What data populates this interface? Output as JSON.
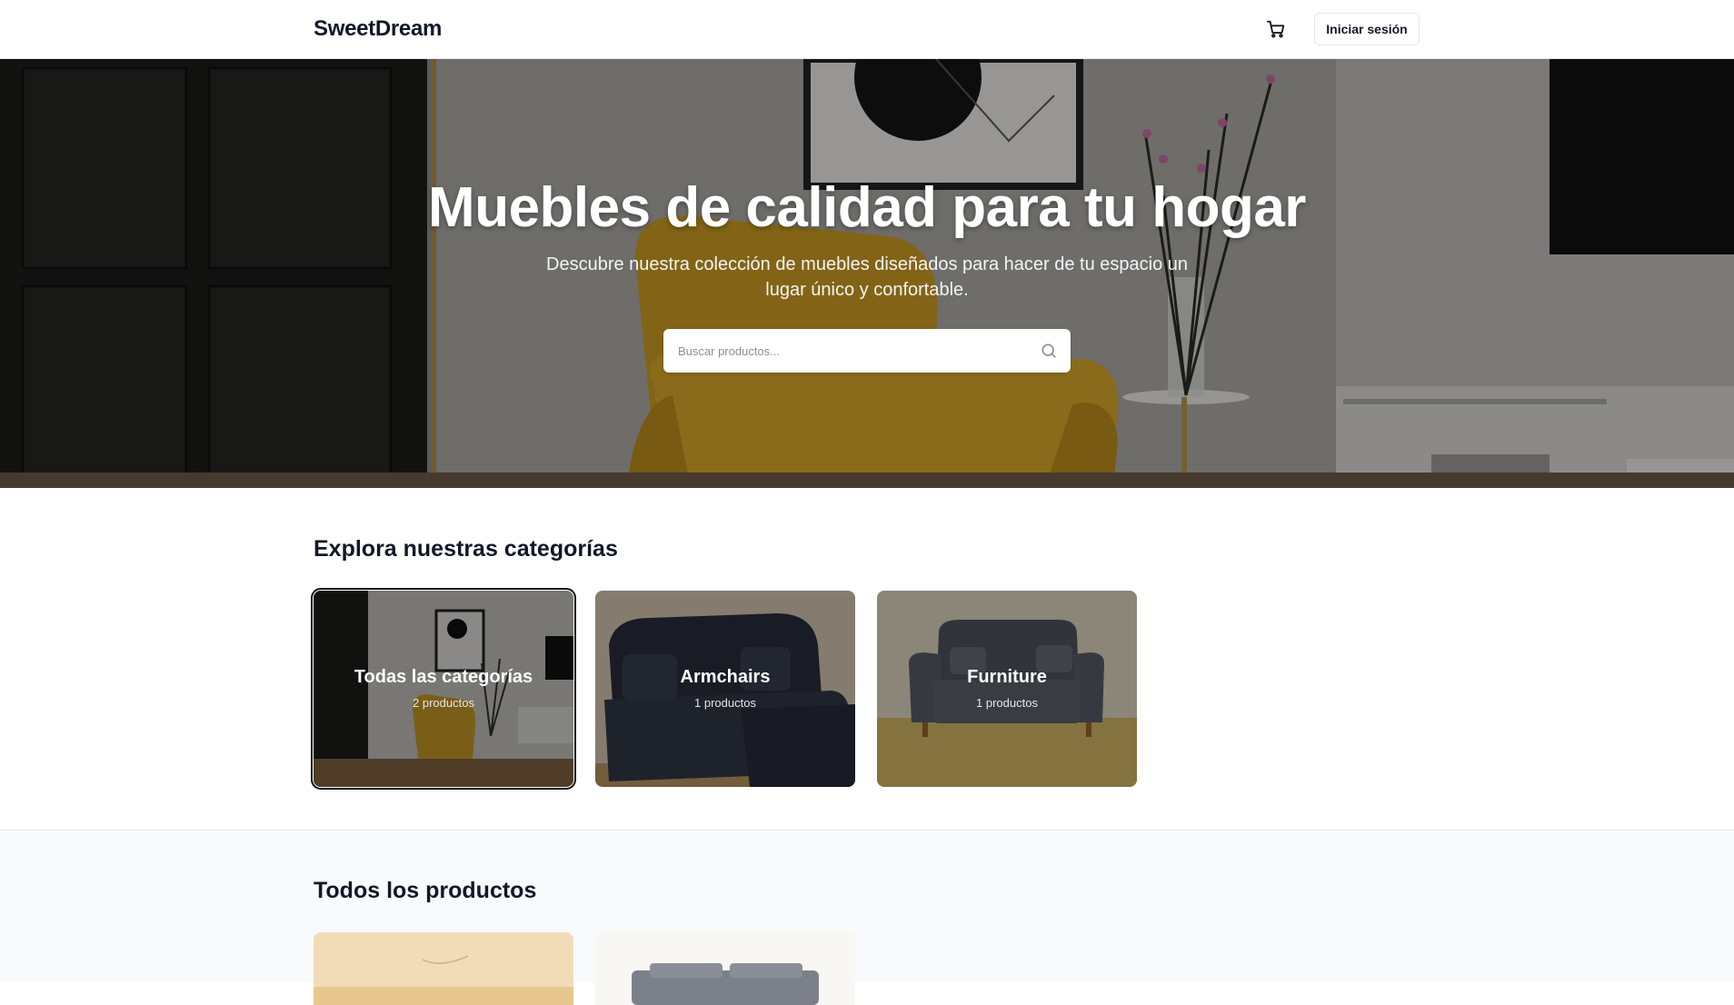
{
  "header": {
    "logo": "SweetDream",
    "cart_icon": "shopping-cart-icon",
    "login_label": "Iniciar sesión"
  },
  "hero": {
    "title": "Muebles de calidad para tu hogar",
    "subtitle": "Descubre nuestra colección de muebles diseñados para hacer de tu espacio un lugar único y confortable.",
    "search_placeholder": "Buscar productos...",
    "search_icon": "search-icon"
  },
  "categories": {
    "title": "Explora nuestras categorías",
    "items": [
      {
        "name": "Todas las categorías",
        "count": "2 productos",
        "selected": true
      },
      {
        "name": "Armchairs",
        "count": "1 productos",
        "selected": false
      },
      {
        "name": "Furniture",
        "count": "1 productos",
        "selected": false
      }
    ]
  },
  "products": {
    "title": "Todos los productos"
  },
  "colors": {
    "text_primary": "#111827",
    "accent_yellow": "#c99a22",
    "sofa_dark": "#2b3140",
    "sofa_gray": "#555b65"
  }
}
